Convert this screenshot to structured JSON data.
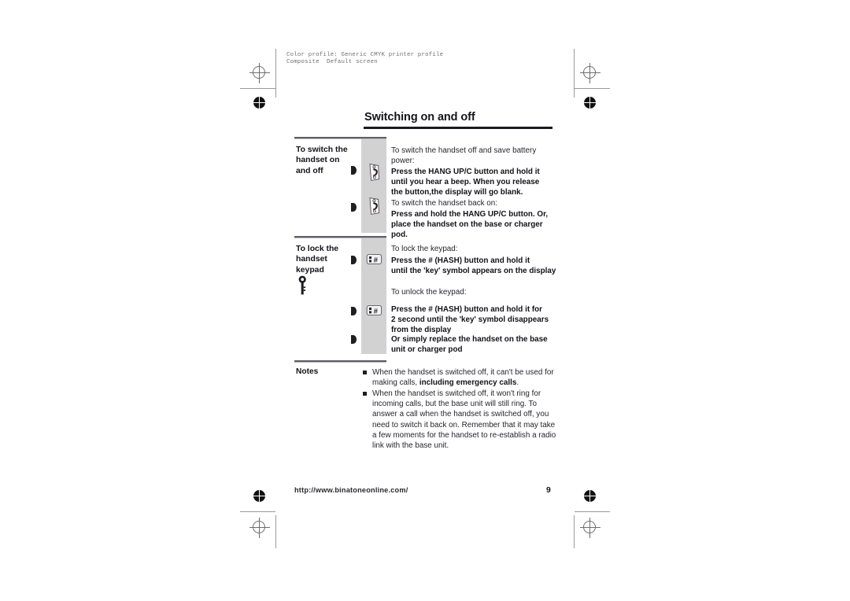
{
  "prepress": {
    "line1": "Color profile: Generic CMYK printer profile",
    "line2": "Composite  Default screen"
  },
  "page": {
    "title": "Switching on and off",
    "footer_url": "http://www.binatoneonline.com/",
    "page_number": "9"
  },
  "sections": [
    {
      "label_line1": "To switch the",
      "label_line2": "handset on",
      "label_line3": "and off",
      "blocks": [
        {
          "intro": "To switch the handset off and save battery power:",
          "bold_line1": "Press the HANG UP/C button and hold it",
          "bold_line2": "until you hear a beep. When you release",
          "bold_line3": "the button,the display will go blank."
        },
        {
          "intro": "To switch the handset back on:",
          "bold_line1": "Press and hold the HANG UP/C button. Or,",
          "bold_line2": "place the handset on the base or charger pod."
        }
      ]
    },
    {
      "label_line1": "To lock the",
      "label_line2": "handset",
      "label_line3": "keypad",
      "blocks": [
        {
          "intro": "To lock the keypad:",
          "bold_line1": "Press the # (HASH) button and hold it",
          "bold_line2": "until the 'key' symbol appears on the display"
        },
        {
          "intro": "To unlock the keypad:",
          "bold_line1": "Press the # (HASH) button and hold it for",
          "bold_line2": "2 second until the 'key' symbol disappears",
          "bold_line3": "from the display"
        },
        {
          "bold_line1": "Or simply replace the handset on the base",
          "bold_line2": "unit or charger pod"
        }
      ]
    }
  ],
  "notes": {
    "label": "Notes",
    "items": [
      "When the handset is switched off, it can't be used for making calls, including emergency calls.",
      "When the handset is switched off, it won't ring for incoming calls, but the base unit will still ring. To answer a call when the handset is switched off, you need to switch it back on. Remember that it may take a few moments for the handset to re-establish a radio link with the base unit."
    ],
    "item1_plain_a": "When the handset is switched off, it can't be used for",
    "item1_plain_b": "making calls, ",
    "item1_bold": "including emergency calls",
    "item1_tail": ".",
    "item2_lines": [
      "When the handset is switched off, it won't ring for",
      "incoming calls, but the base unit will still ring. To",
      "answer a call when the handset is switched off, you",
      "need to switch it back on. Remember that it may take",
      "a few moments for the handset to re-establish a radio",
      "link with the base unit."
    ]
  },
  "icons": {
    "handset": "handset-icon",
    "hash_button": "hash-button-icon",
    "key": "key-icon",
    "marker": "arrow-marker-icon",
    "registration": "registration-mark-icon",
    "color_dot": "color-target-icon"
  },
  "colors": {
    "gray_column": "#d2d2d2",
    "rule": "#5e5e66",
    "text": "#26252c",
    "title": "#14131a"
  }
}
